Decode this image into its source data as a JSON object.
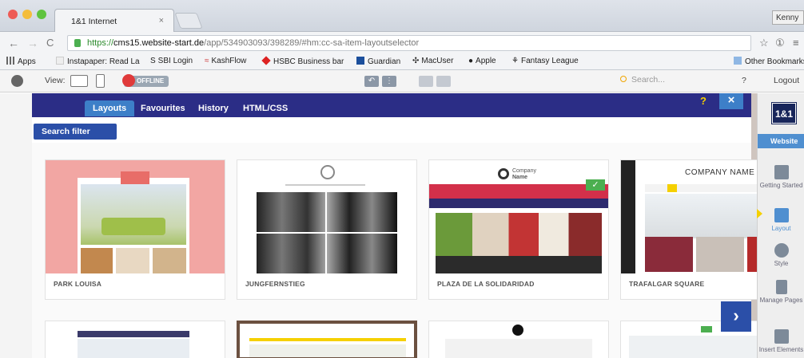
{
  "browser": {
    "tab_title": "1&1 Internet",
    "tab_close": "×",
    "profile_name": "Kenny",
    "url": {
      "scheme": "https://",
      "host": "cms15.website-start.de",
      "path": "/app/534903093/398289/#hm:cc-sa-item-layoutselector"
    },
    "bookmarks": [
      "Apps",
      "Instapaper: Read La",
      "SBI Login",
      "KashFlow",
      "HSBC Business bar",
      "Guardian",
      "MacUser",
      "Apple",
      "Fantasy League"
    ],
    "other_bookmarks": "Other Bookmarks"
  },
  "cms_toolbar": {
    "view_label": "View:",
    "offline_label": "OFFLINE",
    "search_placeholder": "Search...",
    "help": "?",
    "logout": "Logout"
  },
  "panel": {
    "tabs": [
      "Layouts",
      "Favourites",
      "History",
      "HTML/CSS"
    ],
    "help": "?",
    "close": "×",
    "search_filter": "Search filter",
    "next": "›"
  },
  "layouts": [
    {
      "name": "PARK LOUISA"
    },
    {
      "name": "JUNGFERNSTIEG"
    },
    {
      "name": "PLAZA DE LA SOLIDARIDAD",
      "selected": true
    },
    {
      "name": "TRAFALGAR SQUARE"
    }
  ],
  "thumb_text": {
    "company_name": "COMPANY NAME",
    "company": "Company",
    "name": "Name"
  },
  "sidebar": {
    "logo": "1&1",
    "section": "Website",
    "items": [
      "Getting Started",
      "Layout",
      "Style",
      "Manage Pages",
      "Insert Elements"
    ]
  },
  "colors": {
    "panel_header": "#2b2d86",
    "accent_blue": "#3d7fc8",
    "sidebar_active": "#4f8fd0",
    "selected_check": "#4caf50"
  }
}
